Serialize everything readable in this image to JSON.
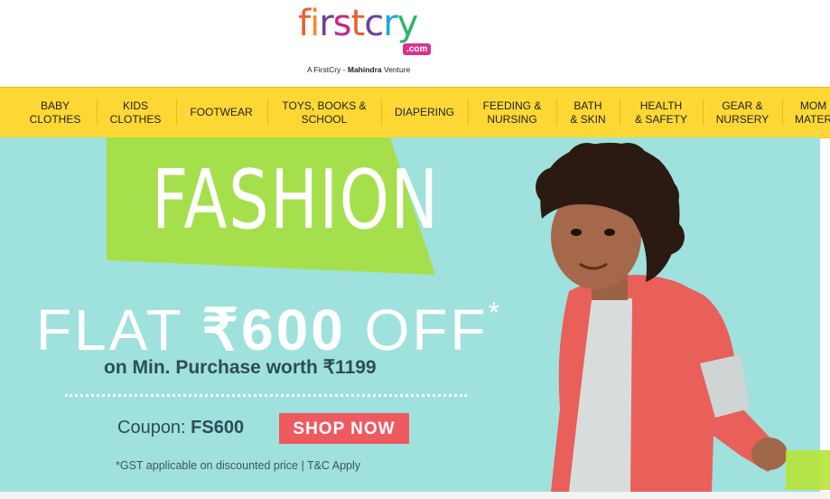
{
  "logo": {
    "word": [
      "f",
      "i",
      "r",
      "s",
      "t",
      "c",
      "r",
      "y"
    ],
    "com": ".com",
    "tagline_pre": "A FirstCry - ",
    "tagline_brand": "Mahindra",
    "tagline_post": " Venture"
  },
  "nav": {
    "items": [
      {
        "label": "BABY\nCLOTHES"
      },
      {
        "label": "KIDS\nCLOTHES"
      },
      {
        "label": "FOOTWEAR"
      },
      {
        "label": "TOYS, BOOKS &\nSCHOOL"
      },
      {
        "label": "DIAPERING"
      },
      {
        "label": "FEEDING &\nNURSING"
      },
      {
        "label": "BATH\n& SKIN"
      },
      {
        "label": "HEALTH\n& SAFETY"
      },
      {
        "label": "GEAR &\nNURSERY"
      },
      {
        "label": "MOM\nMATER"
      }
    ]
  },
  "banner": {
    "headline": "FASHION",
    "offer_prefix": "FLAT ",
    "offer_amount": "₹600",
    "offer_suffix": " OFF",
    "offer_star": "*",
    "min_purchase": "on Min. Purchase worth ₹1199",
    "coupon_label": "Coupon: ",
    "coupon_code": "FS600",
    "cta": "SHOP NOW",
    "disclaimer": "*GST applicable on discounted price  |  T&C Apply"
  },
  "colors": {
    "nav_bg": "#fdd835",
    "banner_bg": "#9fe1dc",
    "banner_green": "#a5e04c",
    "cta_bg": "#ef5a61"
  }
}
